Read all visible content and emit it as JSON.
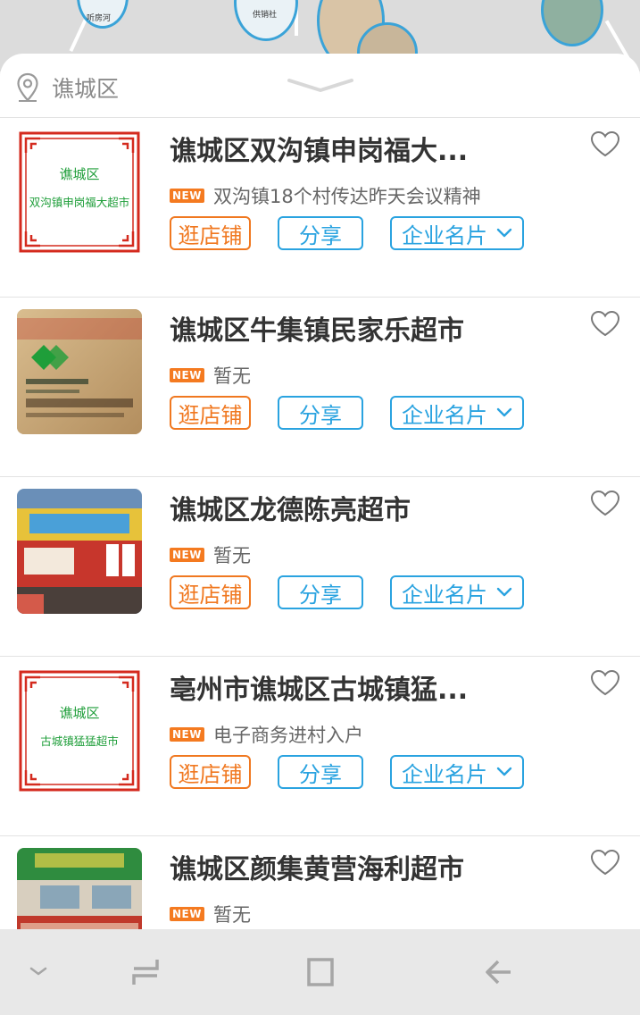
{
  "map": {
    "label_1": "听房河",
    "label_2": "供销社"
  },
  "location": {
    "icon": "location-pin-icon",
    "text": "谯城区"
  },
  "shops": [
    {
      "title": "谯城区双沟镇申岗福大...",
      "news": "双沟镇18个村传达昨天会议精神",
      "thumb": "sign",
      "sign_line1": "谯城区",
      "sign_line2": "双沟镇申岗福大超市"
    },
    {
      "title": "谯城区牛集镇民家乐超市",
      "news": "暂无",
      "thumb": "photo-plaque"
    },
    {
      "title": "谯城区龙德陈亮超市",
      "news": "暂无",
      "thumb": "photo-storefront"
    },
    {
      "title": "亳州市谯城区古城镇猛...",
      "news": "电子商务进村入户",
      "thumb": "sign",
      "sign_line1": "谯城区",
      "sign_line2": "古城镇猛猛超市"
    },
    {
      "title": "谯城区颜集黄营海利超市",
      "news": "暂无",
      "thumb": "photo-building"
    }
  ],
  "labels": {
    "new_badge": "NEW",
    "visit_store": "逛店铺",
    "share": "分享",
    "business_card": "企业名片"
  },
  "colors": {
    "orange": "#f07820",
    "blue": "#2aa3e0",
    "sign_red": "#d42a1e",
    "sign_green": "#1f9e3a"
  }
}
